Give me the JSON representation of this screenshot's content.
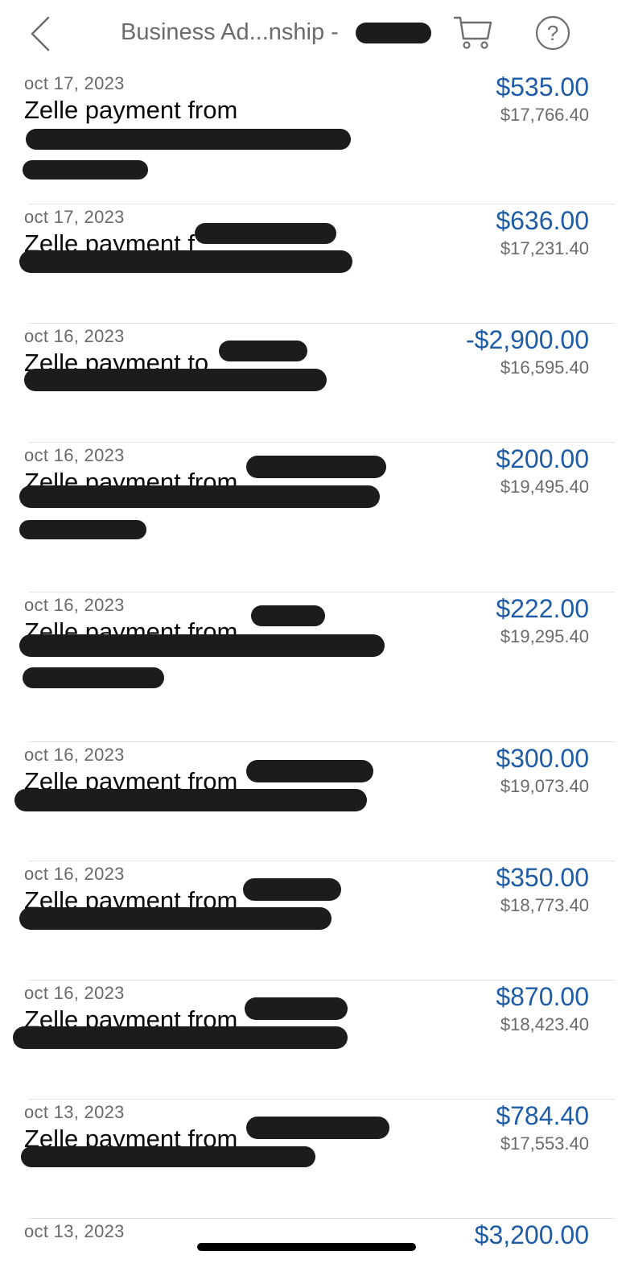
{
  "header": {
    "title": "Business Ad...nship -",
    "back_icon": "chevron-left-icon",
    "cart_icon": "cart-icon",
    "help_icon": "help-icon"
  },
  "colors": {
    "amount": "#1f5ca6",
    "secondary_text": "#6a6a6a",
    "redaction": "#1c1c1c"
  },
  "transactions": [
    {
      "date": "oct 17, 2023",
      "description": "Zelle payment from",
      "amount": "$535.00",
      "balance": "$17,766.40"
    },
    {
      "date": "oct 17, 2023",
      "description": "Zelle payment f",
      "amount": "$636.00",
      "balance": "$17,231.40"
    },
    {
      "date": "oct 16, 2023",
      "description": "Zelle payment to",
      "amount": "-$2,900.00",
      "balance": "$16,595.40"
    },
    {
      "date": "oct 16, 2023",
      "description": "Zelle payment from",
      "amount": "$200.00",
      "balance": "$19,495.40"
    },
    {
      "date": "oct 16, 2023",
      "description": "Zelle payment from",
      "amount": "$222.00",
      "balance": "$19,295.40"
    },
    {
      "date": "oct 16, 2023",
      "description": "Zelle payment from",
      "amount": "$300.00",
      "balance": "$19,073.40"
    },
    {
      "date": "oct 16, 2023",
      "description": "Zelle payment from",
      "amount": "$350.00",
      "balance": "$18,773.40"
    },
    {
      "date": "oct 16, 2023",
      "description": "Zelle payment from",
      "amount": "$870.00",
      "balance": "$18,423.40"
    },
    {
      "date": "oct 13, 2023",
      "description": "Zelle payment from",
      "amount": "$784.40",
      "balance": "$17,553.40"
    },
    {
      "date": "oct 13, 2023",
      "description": "",
      "amount": "$3,200.00",
      "balance": ""
    }
  ]
}
